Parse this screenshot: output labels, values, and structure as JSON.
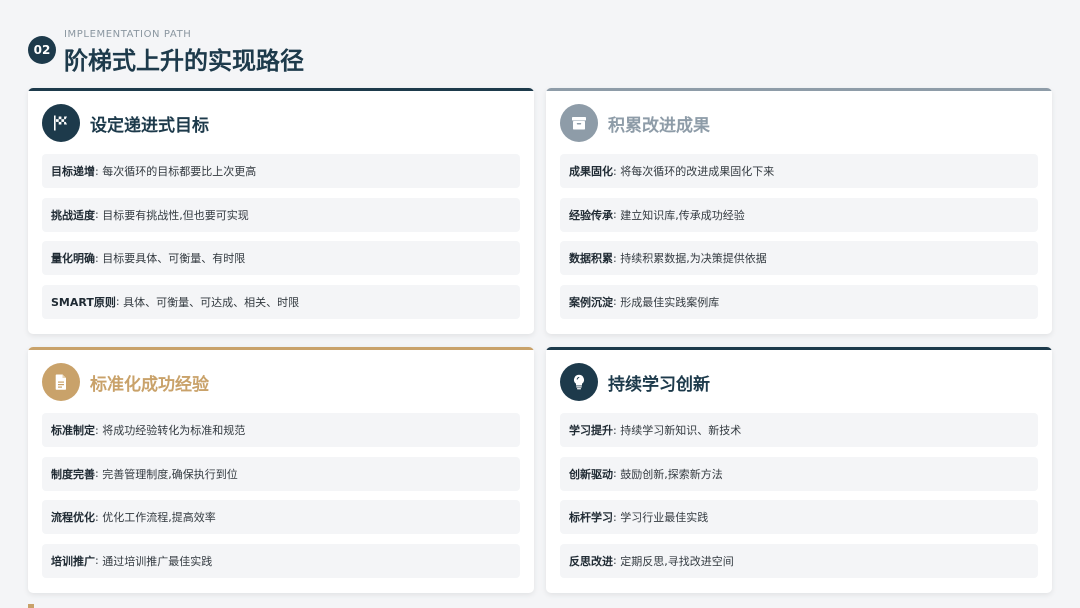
{
  "header": {
    "badge": "02",
    "subtitle": "IMPLEMENTATION PATH",
    "title": "阶梯式上升的实现路径"
  },
  "cards": [
    {
      "title": "设定递进式目标",
      "icon": "flag-checkered-icon",
      "accent": "#1d3a4b",
      "title_color": "#1d3a4b",
      "items": [
        {
          "key": "目标递增",
          "text": "每次循环的目标都要比上次更高"
        },
        {
          "key": "挑战适度",
          "text": "目标要有挑战性,但也要可实现"
        },
        {
          "key": "量化明确",
          "text": "目标要具体、可衡量、有时限"
        },
        {
          "key": "SMART原则",
          "text": "具体、可衡量、可达成、相关、时限"
        }
      ]
    },
    {
      "title": "积累改进成果",
      "icon": "archive-box-icon",
      "accent": "#8e9ca8",
      "title_color": "#8e9ca8",
      "items": [
        {
          "key": "成果固化",
          "text": "将每次循环的改进成果固化下来"
        },
        {
          "key": "经验传承",
          "text": "建立知识库,传承成功经验"
        },
        {
          "key": "数据积累",
          "text": "持续积累数据,为决策提供依据"
        },
        {
          "key": "案例沉淀",
          "text": "形成最佳实践案例库"
        }
      ]
    },
    {
      "title": "标准化成功经验",
      "icon": "document-icon",
      "accent": "#c9a26a",
      "title_color": "#c9a26a",
      "items": [
        {
          "key": "标准制定",
          "text": "将成功经验转化为标准和规范"
        },
        {
          "key": "制度完善",
          "text": "完善管理制度,确保执行到位"
        },
        {
          "key": "流程优化",
          "text": "优化工作流程,提高效率"
        },
        {
          "key": "培训推广",
          "text": "通过培训推广最佳实践"
        }
      ]
    },
    {
      "title": "持续学习创新",
      "icon": "lightbulb-icon",
      "accent": "#1d3a4b",
      "title_color": "#1d3a4b",
      "items": [
        {
          "key": "学习提升",
          "text": "持续学习新知识、新技术"
        },
        {
          "key": "创新驱动",
          "text": "鼓励创新,探索新方法"
        },
        {
          "key": "标杆学习",
          "text": "学习行业最佳实践"
        },
        {
          "key": "反思改进",
          "text": "定期反思,寻找改进空间"
        }
      ]
    }
  ]
}
